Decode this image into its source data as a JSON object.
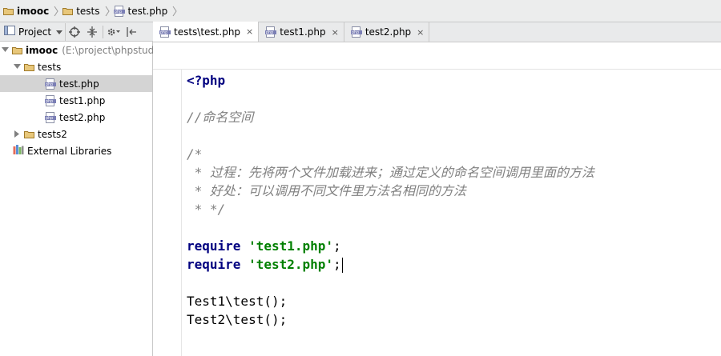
{
  "breadcrumb": {
    "items": [
      {
        "label": "imooc",
        "icon": "folder-icon"
      },
      {
        "label": "tests",
        "icon": "folder-icon"
      },
      {
        "label": "test.php",
        "icon": "php-file-icon"
      }
    ]
  },
  "project_panel": {
    "view_label": "Project",
    "tree": {
      "root": {
        "label": "imooc",
        "path": "(E:\\project\\phpstudy"
      },
      "tests_folder": "tests",
      "files": [
        "test.php",
        "test1.php",
        "test2.php"
      ],
      "tests2_folder": "tests2",
      "external_libraries": "External Libraries"
    }
  },
  "tabs": [
    {
      "label": "tests\\test.php",
      "close": "×",
      "active": true
    },
    {
      "label": "test1.php",
      "close": "×",
      "active": false
    },
    {
      "label": "test2.php",
      "close": "×",
      "active": false
    }
  ],
  "code": {
    "open_tag": "<?php",
    "comment_namespace": "//命名空间",
    "doc_open": "/*",
    "doc_line1": " * 过程：先将两个文件加载进来；通过定义的命名空间调用里面的方法",
    "doc_line2": " * 好处：可以调用不同文件里方法名相同的方法",
    "doc_close": " * */",
    "require_kw": "require",
    "require1_str": "'test1.php'",
    "require2_str": "'test2.php'",
    "semicolon": ";",
    "call1": "Test1\\test();",
    "call2": "Test2\\test();"
  },
  "colors": {
    "keyword": "#000080",
    "string": "#008000",
    "comment": "#808080",
    "caret_line": "#fffae3",
    "selection": "#d4d4d4"
  }
}
